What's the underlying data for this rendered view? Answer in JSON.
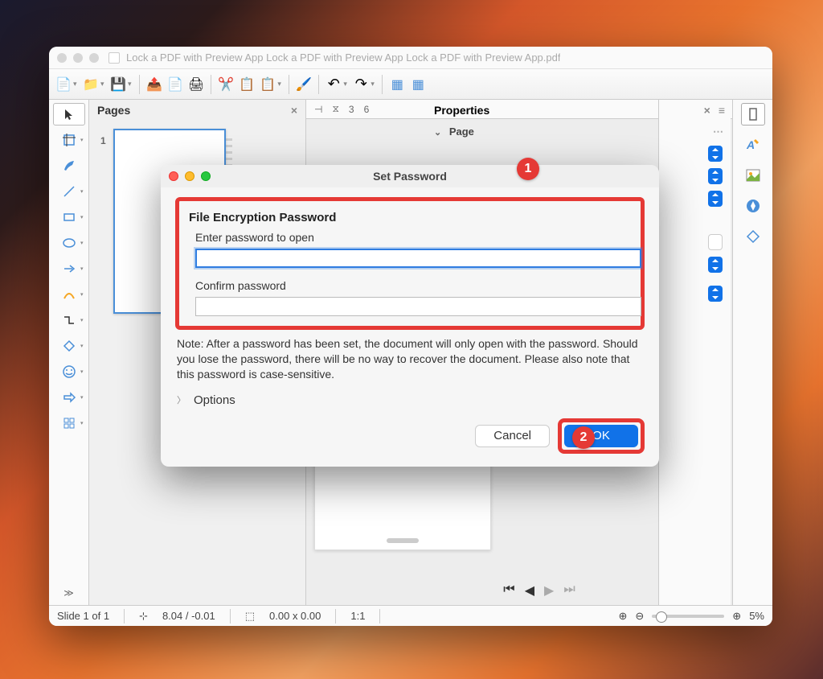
{
  "window": {
    "title": "Lock a PDF with Preview App Lock a PDF with Preview App Lock a PDF with Preview App.pdf"
  },
  "panels": {
    "pages_title": "Pages",
    "properties_title": "Properties",
    "properties_section": "Page",
    "page_number": "1"
  },
  "ruler": {
    "a": "3",
    "b": "6"
  },
  "dialog": {
    "title": "Set Password",
    "section": "File Encryption Password",
    "enter_label": "Enter password to open",
    "confirm_label": "Confirm password",
    "note": "Note: After a password has been set, the document will only open with the password. Should you lose the password, there will be no way to recover the document. Please also note that this password is case-sensitive.",
    "options": "Options",
    "cancel": "Cancel",
    "ok": "OK"
  },
  "callouts": {
    "one": "1",
    "two": "2"
  },
  "statusbar": {
    "slide": "Slide 1 of 1",
    "coords": "8.04 / -0.01",
    "size": "0.00 x 0.00",
    "ratio": "1:1",
    "zoom": "5%"
  },
  "icons": {
    "new": "🟧",
    "open": "📁",
    "save": "💾",
    "export": "📤",
    "pdf": "📄",
    "print": "🖨",
    "cut": "✂",
    "copy": "📋",
    "paste": "📋",
    "brush": "🖌",
    "undo": "↶",
    "redo": "↷",
    "grid1": "▦",
    "grid2": "▦"
  }
}
